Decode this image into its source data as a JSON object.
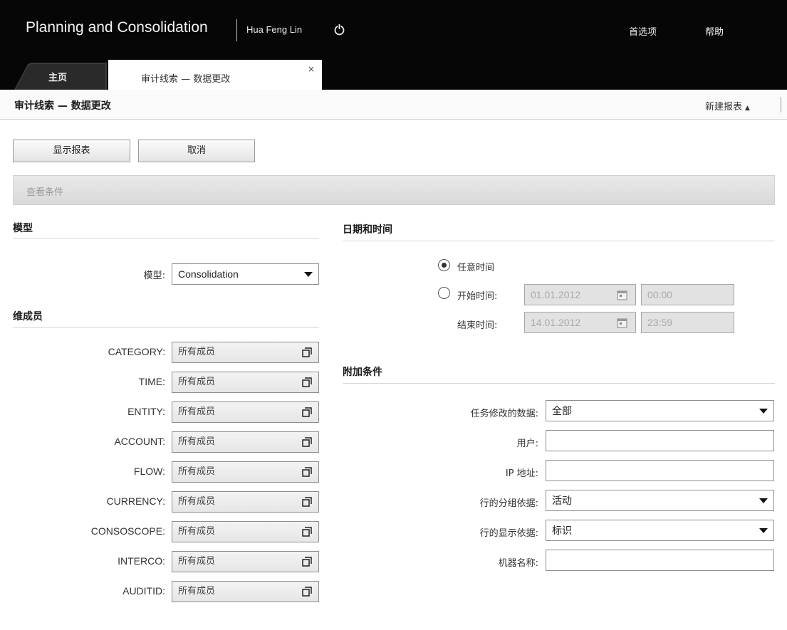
{
  "header": {
    "app_title": "Planning and Consolidation",
    "user_name": "Hua Feng Lin",
    "preferences": "首选项",
    "help": "帮助"
  },
  "tabs": [
    {
      "label": "主页"
    },
    {
      "label": "审计线索 — 数据更改",
      "close": "×"
    }
  ],
  "page": {
    "title": "审计线索 — 数据更改",
    "new_report": "新建报表",
    "new_report_caret": "▲"
  },
  "buttons": {
    "show_report": "显示报表",
    "cancel": "取消"
  },
  "filter_bar": {
    "label": "查看条件"
  },
  "model_section": {
    "title": "模型",
    "model_label": "模型:",
    "model_value": "Consolidation"
  },
  "dimension_section": {
    "title": "维成员",
    "members": [
      {
        "label": "CATEGORY:",
        "value": "所有成员"
      },
      {
        "label": "TIME:",
        "value": "所有成员"
      },
      {
        "label": "ENTITY:",
        "value": "所有成员"
      },
      {
        "label": "ACCOUNT:",
        "value": "所有成员"
      },
      {
        "label": "FLOW:",
        "value": "所有成员"
      },
      {
        "label": "CURRENCY:",
        "value": "所有成员"
      },
      {
        "label": "CONSOSCOPE:",
        "value": "所有成员"
      },
      {
        "label": "INTERCO:",
        "value": "所有成员"
      },
      {
        "label": "AUDITID:",
        "value": "所有成员"
      }
    ]
  },
  "date_section": {
    "title": "日期和时间",
    "any_time": "任意时间",
    "start_label": "开始时间:",
    "start_date": "01.01.2012",
    "start_time": "00:00",
    "end_label": "结束时间:",
    "end_date": "14.01.2012",
    "end_time": "23:59"
  },
  "extra_section": {
    "title": "附加条件",
    "task_label": "任务修改的数据:",
    "task_value": "全部",
    "user_label": "用户:",
    "user_value": "",
    "ip_label": "IP 地址:",
    "ip_value": "",
    "group_label": "行的分组依据:",
    "group_value": "活动",
    "display_label": "行的显示依据:",
    "display_value": "标识",
    "machine_label": "机器名称:",
    "machine_value": ""
  }
}
